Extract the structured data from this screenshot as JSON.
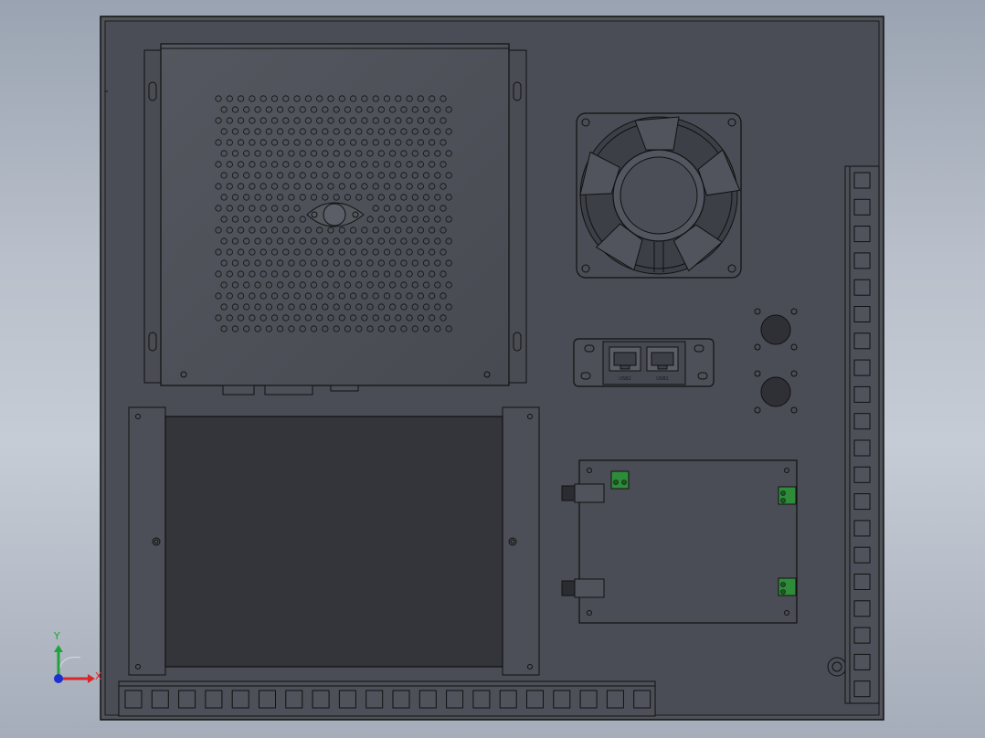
{
  "scene": {
    "panel_color": "#4b4e56",
    "edge_color": "#141414",
    "fan_guard_count": 5,
    "computer_grill": {
      "rows": 22,
      "cols": 22
    },
    "terminal_bottom_count": 20,
    "terminal_right_count": 20
  },
  "ports": {
    "left_label": "USB2",
    "right_label": "USB1"
  },
  "triad": {
    "x_label": "X",
    "y_label": "Y",
    "x_color": "#d8262b",
    "y_color": "#1fa33a",
    "z_color": "#1c2fd1"
  }
}
